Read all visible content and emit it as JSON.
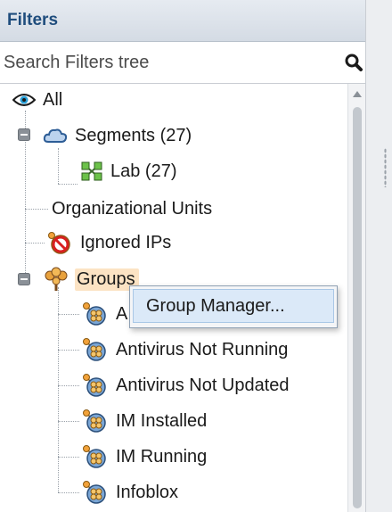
{
  "panel": {
    "title": "Filters",
    "search": {
      "placeholder": "Search Filters tree",
      "value": ""
    }
  },
  "tree": {
    "all": {
      "label": "All",
      "icon": "eye-icon"
    },
    "segments": {
      "label": "Segments (27)",
      "icon": "cloud-icon"
    },
    "lab": {
      "label": "Lab (27)",
      "icon": "network-icon"
    },
    "org_units": {
      "label": "Organizational Units"
    },
    "ignored_ips": {
      "label": "Ignored IPs",
      "icon": "ignored-ips-icon"
    },
    "groups": {
      "label": "Groups",
      "icon": "groups-tree-icon"
    },
    "group_items": [
      {
        "label": "A",
        "icon": "group-icon"
      },
      {
        "label": "Antivirus Not Running",
        "icon": "group-icon"
      },
      {
        "label": "Antivirus Not Updated",
        "icon": "group-icon"
      },
      {
        "label": "IM Installed",
        "icon": "group-icon"
      },
      {
        "label": "IM Running",
        "icon": "group-icon"
      },
      {
        "label": "Infoblox",
        "icon": "group-icon"
      }
    ]
  },
  "context_menu": {
    "items": [
      {
        "label": "Group Manager..."
      }
    ]
  },
  "colors": {
    "header_text": "#1f4d7d",
    "selection": "#fce3c4",
    "menu_highlight": "#dbe9f8"
  }
}
